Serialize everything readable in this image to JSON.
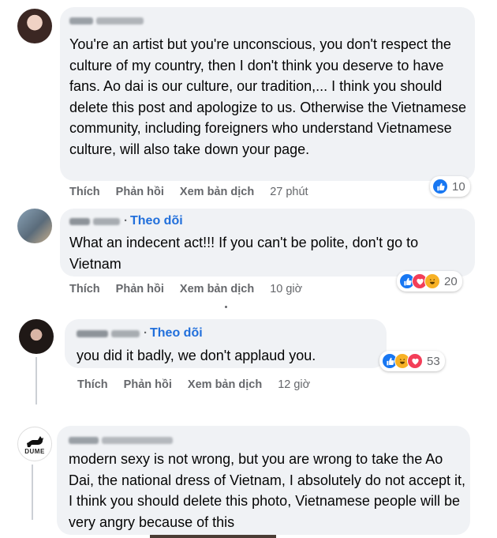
{
  "comments": [
    {
      "name_obscured": true,
      "follow": "",
      "text": "You're an artist but you're unconscious, you don't respect the culture of my country, then I don't think you deserve to have fans. Ao dai is our culture, our tradition,... I think you should delete this post and apologize to us. Otherwise the Vietnamese community, including foreigners who understand Vietnamese culture, will also take down your page.",
      "actions": {
        "like": "Thích",
        "reply": "Phản hồi",
        "translate": "Xem bản dịch",
        "time": "27 phút"
      },
      "reactions": {
        "icons": [
          "like"
        ],
        "count": "10"
      }
    },
    {
      "name_obscured": true,
      "follow": "Theo dõi",
      "text": "What an indecent act!!! If you can't be polite, don't go to Vietnam",
      "actions": {
        "like": "Thích",
        "reply": "Phản hồi",
        "translate": "Xem bản dịch",
        "time": "10 giờ"
      },
      "reactions": {
        "icons": [
          "like",
          "love",
          "haha"
        ],
        "count": "20"
      }
    },
    {
      "name_obscured": true,
      "follow": "Theo dõi",
      "text": "you did it badly, we don't applaud you.",
      "actions": {
        "like": "Thích",
        "reply": "Phản hồi",
        "translate": "Xem bản dịch",
        "time": "12 giờ"
      },
      "reactions": {
        "icons": [
          "like",
          "haha",
          "love"
        ],
        "count": "53"
      }
    },
    {
      "name_obscured": true,
      "follow": "",
      "avatar_text": "DUME",
      "text": "modern sexy is not wrong, but you are wrong to take the Ao Dai, the national dress of Vietnam, I absolutely do not accept it, I think you should delete this photo, Vietnamese people will be very angry because of this"
    }
  ],
  "colors": {
    "link": "#216fdb",
    "like": "#1877f2",
    "love": "#f33e58",
    "haha": "#f7b125",
    "bubble": "#f0f2f5"
  }
}
